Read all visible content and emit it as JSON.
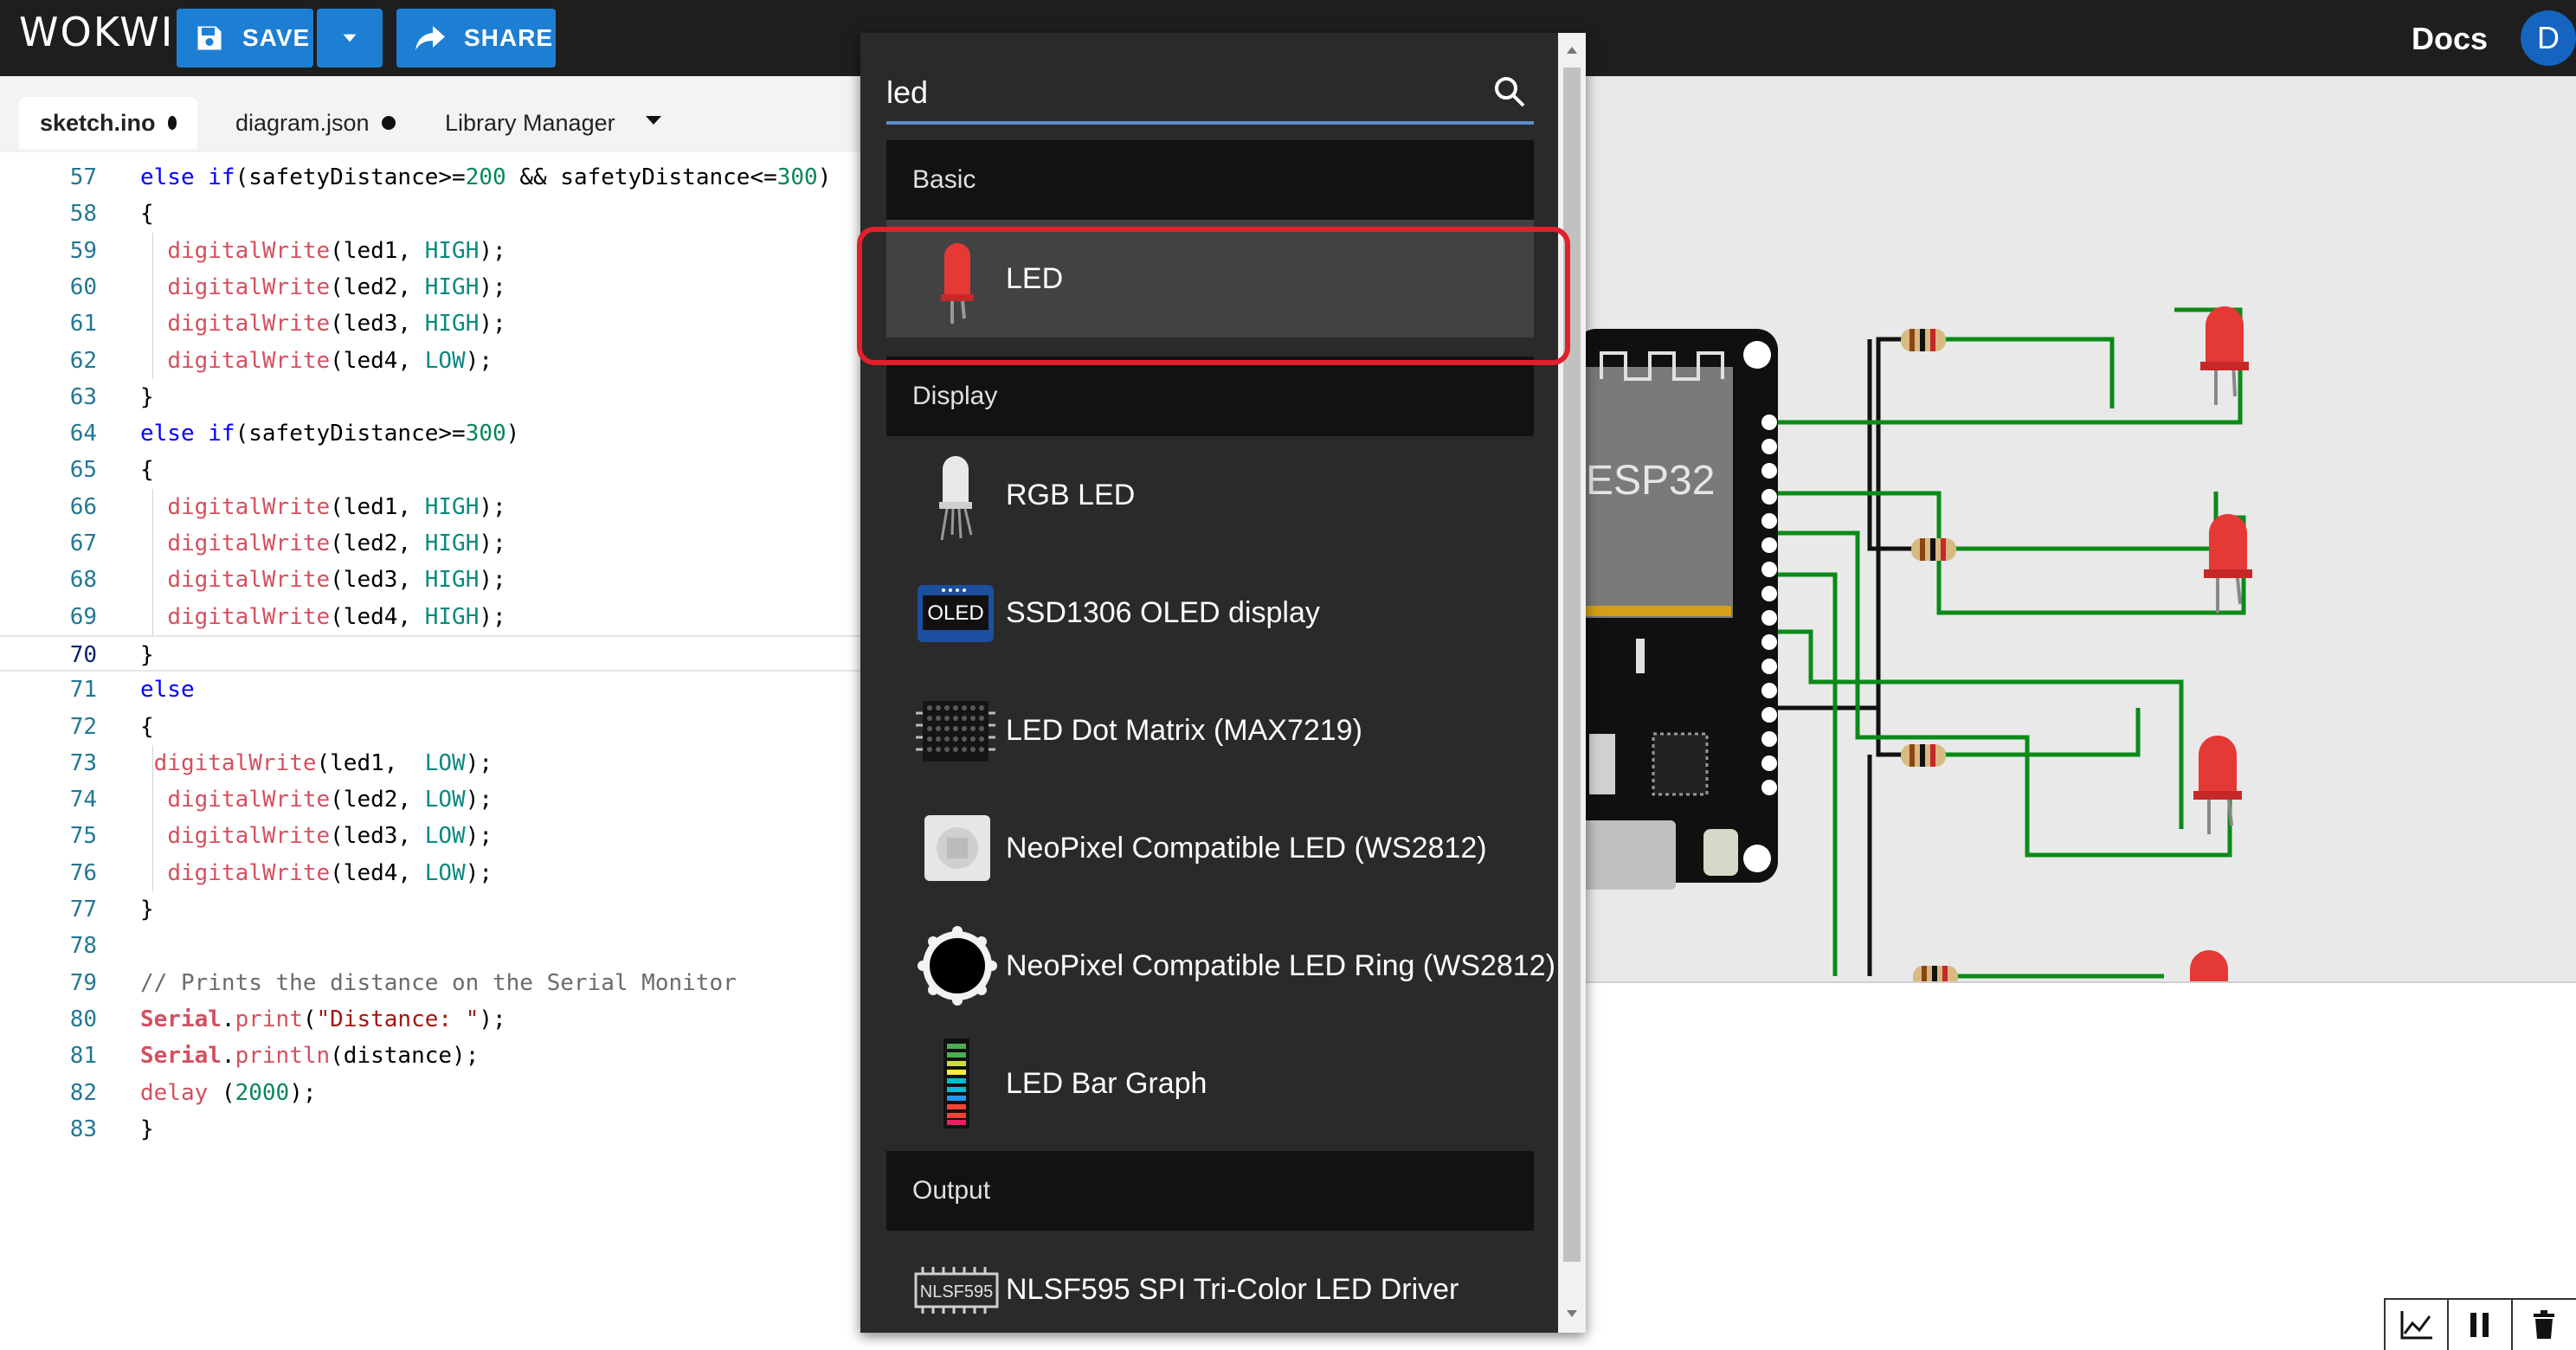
{
  "app": {
    "logo": "WOKWI",
    "save_label": "SAVE",
    "share_label": "SHARE",
    "docs_label": "Docs",
    "avatar_initial": "D"
  },
  "tabs": [
    {
      "label": "sketch.ino",
      "active": true,
      "modified": true
    },
    {
      "label": "diagram.json",
      "active": false,
      "modified": true
    },
    {
      "label": "Library Manager",
      "active": false,
      "modified": false
    }
  ],
  "editor": {
    "current_line": "70",
    "lines": [
      {
        "n": "57",
        "code": "else if(safetyDistance>=200 && safetyDistance<=300)"
      },
      {
        "n": "58",
        "code": "{"
      },
      {
        "n": "59",
        "code": "  digitalWrite(led1, HIGH);"
      },
      {
        "n": "60",
        "code": "  digitalWrite(led2, HIGH);"
      },
      {
        "n": "61",
        "code": "  digitalWrite(led3, HIGH);"
      },
      {
        "n": "62",
        "code": "  digitalWrite(led4, LOW);"
      },
      {
        "n": "63",
        "code": "}"
      },
      {
        "n": "64",
        "code": "else if(safetyDistance>=300)"
      },
      {
        "n": "65",
        "code": "{"
      },
      {
        "n": "66",
        "code": "  digitalWrite(led1, HIGH);"
      },
      {
        "n": "67",
        "code": "  digitalWrite(led2, HIGH);"
      },
      {
        "n": "68",
        "code": "  digitalWrite(led3, HIGH);"
      },
      {
        "n": "69",
        "code": "  digitalWrite(led4, HIGH);"
      },
      {
        "n": "70",
        "code": "}"
      },
      {
        "n": "71",
        "code": "else"
      },
      {
        "n": "72",
        "code": "{"
      },
      {
        "n": "73",
        "code": " digitalWrite(led1,  LOW);"
      },
      {
        "n": "74",
        "code": "  digitalWrite(led2, LOW);"
      },
      {
        "n": "75",
        "code": "  digitalWrite(led3, LOW);"
      },
      {
        "n": "76",
        "code": "  digitalWrite(led4, LOW);"
      },
      {
        "n": "77",
        "code": "}"
      },
      {
        "n": "78",
        "code": ""
      },
      {
        "n": "79",
        "code": "// Prints the distance on the Serial Monitor"
      },
      {
        "n": "80",
        "code": "Serial.print(\"Distance: \");"
      },
      {
        "n": "81",
        "code": "Serial.println(distance);"
      },
      {
        "n": "82",
        "code": "delay (2000);"
      },
      {
        "n": "83",
        "code": "}"
      }
    ]
  },
  "picker": {
    "search_value": "led",
    "groups": [
      {
        "header": "Basic",
        "items": [
          {
            "label": "LED",
            "icon": "red-led-icon",
            "selected": true
          }
        ]
      },
      {
        "header": "Display",
        "items": [
          {
            "label": "RGB LED",
            "icon": "rgb-led-icon",
            "selected": false
          },
          {
            "label": "SSD1306 OLED display",
            "icon": "oled-display-icon",
            "icon_text": "OLED",
            "selected": false
          },
          {
            "label": "LED Dot Matrix (MAX7219)",
            "icon": "dot-matrix-icon",
            "selected": false
          },
          {
            "label": "NeoPixel Compatible LED (WS2812)",
            "icon": "neopixel-icon",
            "selected": false
          },
          {
            "label": "NeoPixel Compatible LED Ring (WS2812)",
            "icon": "neopixel-ring-icon",
            "selected": false
          },
          {
            "label": "LED Bar Graph",
            "icon": "led-bar-graph-icon",
            "selected": false
          }
        ]
      },
      {
        "header": "Output",
        "items": [
          {
            "label": "NLSF595 SPI Tri-Color LED Driver",
            "icon": "led-driver-chip-icon",
            "icon_text": "NLSF595",
            "selected": false
          }
        ]
      }
    ]
  },
  "simulator": {
    "board_label": "ESP32",
    "led_color": "#e53935",
    "wire_colors": {
      "signal": "#0b8a18",
      "ground": "#111111"
    }
  },
  "colors": {
    "topbar": "#1e1e1e",
    "accent": "#1d7fd3",
    "highlight": "#e0202a",
    "picker_bg": "#2a2a2a"
  }
}
